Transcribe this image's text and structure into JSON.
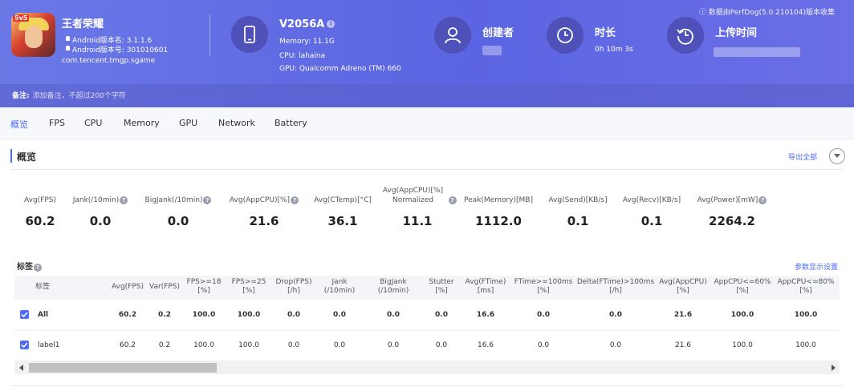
{
  "notice": "数据由PerfDog(5.0.210104)版本收集",
  "app": {
    "name": "王者荣耀",
    "version_name_label": "Android版本名: 3.1.1.6",
    "version_code_label": "Android版本号: 301010601",
    "package": "com.tencent.tmgp.sgame",
    "icon_badge": "5v5"
  },
  "device": {
    "name": "V2056A",
    "memory": "Memory: 11.1G",
    "cpu": "CPU: lahaina",
    "gpu": "GPU: Qualcomm Adreno (TM) 660"
  },
  "stats": {
    "creator_title": "创建者",
    "duration_title": "时长",
    "duration_value": "0h 10m 3s",
    "upload_title": "上传时间"
  },
  "remark": {
    "label": "备注:",
    "placeholder": "添加备注，不超过200个字符"
  },
  "tabs": [
    "概览",
    "FPS",
    "CPU",
    "Memory",
    "GPU",
    "Network",
    "Battery"
  ],
  "overview": {
    "title": "概览",
    "export_label": "导出全部"
  },
  "metrics": [
    {
      "label": "Avg(FPS)",
      "value": "60.2",
      "help": false
    },
    {
      "label": "Jank(/10min)",
      "value": "0.0",
      "help": true
    },
    {
      "label": "BigJank(/10min)",
      "value": "0.0",
      "help": true
    },
    {
      "label": "Avg(AppCPU)[%]",
      "value": "21.6",
      "help": true
    },
    {
      "label": "Avg(CTemp)[°C]",
      "value": "36.1",
      "help": false
    },
    {
      "label": "Avg(AppCPU)[%] Normalized",
      "value": "11.1",
      "help": true
    },
    {
      "label": "Peak(Memory)[MB]",
      "value": "1112.0",
      "help": false
    },
    {
      "label": "Avg(Send)[KB/s]",
      "value": "0.1",
      "help": false
    },
    {
      "label": "Avg(Recv)[KB/s]",
      "value": "0.1",
      "help": false
    },
    {
      "label": "Avg(Power)[mW]",
      "value": "2264.2",
      "help": true
    }
  ],
  "tags": {
    "title": "标签",
    "settings_link": "参数显示设置"
  },
  "table": {
    "columns": [
      {
        "l1": "标签",
        "l2": ""
      },
      {
        "l1": "Avg(FPS)",
        "l2": ""
      },
      {
        "l1": "Var(FPS)",
        "l2": ""
      },
      {
        "l1": "FPS>=18",
        "l2": "[%]"
      },
      {
        "l1": "FPS>=25",
        "l2": "[%]"
      },
      {
        "l1": "Drop(FPS)",
        "l2": "[/h]"
      },
      {
        "l1": "Jank",
        "l2": "(/10min)"
      },
      {
        "l1": "BigJank",
        "l2": "(/10min)"
      },
      {
        "l1": "Stutter",
        "l2": "[%]"
      },
      {
        "l1": "Avg(FTime)",
        "l2": "[ms]"
      },
      {
        "l1": "FTime>=100ms",
        "l2": "[%]"
      },
      {
        "l1": "Delta(FTime)>100ms",
        "l2": "[/h]"
      },
      {
        "l1": "Avg(AppCPU)",
        "l2": "[%]"
      },
      {
        "l1": "AppCPU<=60%",
        "l2": "[%]"
      },
      {
        "l1": "AppCPU<=80%",
        "l2": "[%]"
      }
    ],
    "rows": [
      {
        "name": "All",
        "cells": [
          "60.2",
          "0.2",
          "100.0",
          "100.0",
          "0.0",
          "0.0",
          "0.0",
          "0.0",
          "16.6",
          "0.0",
          "0.0",
          "21.6",
          "100.0",
          "100.0"
        ]
      },
      {
        "name": "label1",
        "cells": [
          "60.2",
          "0.2",
          "100.0",
          "100.0",
          "0.0",
          "0.0",
          "0.0",
          "0.0",
          "16.6",
          "0.0",
          "0.0",
          "21.6",
          "100.0",
          "100.0"
        ]
      }
    ]
  }
}
